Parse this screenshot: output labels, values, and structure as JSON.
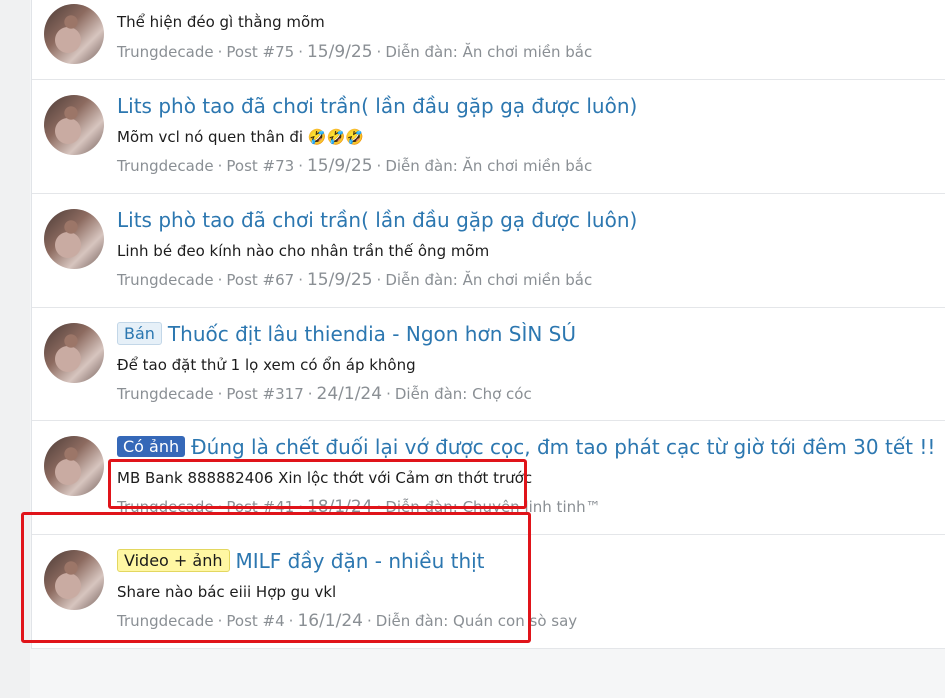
{
  "results": [
    {
      "title": "",
      "badge": "",
      "badge_style": "",
      "snippet": "Thể hiện đéo gì thằng mõm",
      "author": "Trungdecade",
      "post": "Post #75",
      "date": "15/9/25",
      "forum": "Diễn đàn: Ăn chơi miền bắc"
    },
    {
      "title": "Lits phò tao đã chơi trần( lần đầu gặp gạ được luôn)",
      "badge": "",
      "badge_style": "",
      "snippet": "Mõm vcl nó quen thân đi 🤣🤣🤣",
      "author": "Trungdecade",
      "post": "Post #73",
      "date": "15/9/25",
      "forum": "Diễn đàn: Ăn chơi miền bắc"
    },
    {
      "title": "Lits phò tao đã chơi trần( lần đầu gặp gạ được luôn)",
      "badge": "",
      "badge_style": "",
      "snippet": "Linh bé đeo kính nào cho nhân trần thế ông mõm",
      "author": "Trungdecade",
      "post": "Post #67",
      "date": "15/9/25",
      "forum": "Diễn đàn: Ăn chơi miền bắc"
    },
    {
      "title": "Thuốc địt lâu thiendia - Ngon hơn SÌN SÚ",
      "badge": "Bán",
      "badge_style": "ban",
      "snippet": "Để tao đặt thử 1 lọ xem có ổn áp không",
      "author": "Trungdecade",
      "post": "Post #317",
      "date": "24/1/24",
      "forum": "Diễn đàn: Chợ cóc"
    },
    {
      "title": "Đúng là chết đuối lại vớ được cọc, đm tao phát cạc từ giờ tới đêm 30 tết !!",
      "badge": "Có ảnh",
      "badge_style": "coanh",
      "snippet": "MB Bank 888882406 Xin lộc thớt với Cảm ơn thớt trước",
      "author": "Trungdecade",
      "post": "Post #41",
      "date": "18/1/24",
      "forum": "Diễn đàn: Chuyện linh tinh™"
    },
    {
      "title": "MILF đầy đặn - nhiều thịt",
      "badge": "Video + ảnh",
      "badge_style": "video",
      "snippet": "Share nào bác eiii Hợp gu vkl",
      "author": "Trungdecade",
      "post": "Post #4",
      "date": "16/1/24",
      "forum": "Diễn đàn: Quán con sò say"
    }
  ]
}
